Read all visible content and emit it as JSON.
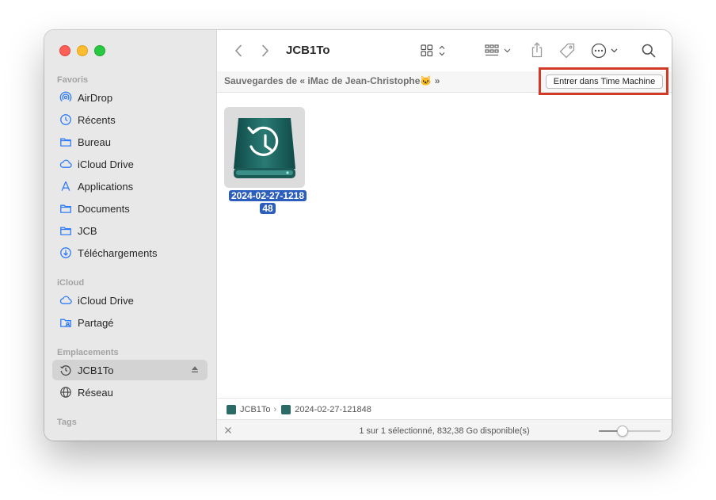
{
  "window": {
    "title": "JCB1To"
  },
  "sidebar": {
    "sections": [
      {
        "title": "Favoris",
        "items": [
          {
            "label": "AirDrop",
            "icon": "airdrop-icon"
          },
          {
            "label": "Récents",
            "icon": "clock-icon"
          },
          {
            "label": "Bureau",
            "icon": "folder-icon"
          },
          {
            "label": "iCloud Drive",
            "icon": "cloud-icon"
          },
          {
            "label": "Applications",
            "icon": "applications-icon"
          },
          {
            "label": "Documents",
            "icon": "folder-icon"
          },
          {
            "label": "JCB",
            "icon": "folder-icon"
          },
          {
            "label": "Téléchargements",
            "icon": "download-icon"
          }
        ]
      },
      {
        "title": "iCloud",
        "items": [
          {
            "label": "iCloud Drive",
            "icon": "cloud-icon"
          },
          {
            "label": "Partagé",
            "icon": "shared-folder-icon"
          }
        ]
      },
      {
        "title": "Emplacements",
        "items": [
          {
            "label": "JCB1To",
            "icon": "time-machine-icon",
            "selected": true
          },
          {
            "label": "Réseau",
            "icon": "globe-icon"
          }
        ]
      },
      {
        "title": "Tags",
        "items": []
      }
    ]
  },
  "time_machine_bar": {
    "backups_label": "Sauvegardes de « iMac de Jean-Christophe🐱 »",
    "enter_button": "Entrer dans Time Machine"
  },
  "files": [
    {
      "name": "2024-02-27-121848",
      "name_line1": "2024-02-27-1218",
      "name_line2": "48",
      "selected": true
    }
  ],
  "pathbar": {
    "items": [
      "JCB1To",
      "2024-02-27-121848"
    ],
    "separator": "›"
  },
  "status": {
    "text": "1 sur 1 sélectionné, 832,38 Go disponible(s)",
    "zoom_level": 0.38
  },
  "colors": {
    "selection": "#2c5fbd",
    "highlight": "#d03a26",
    "sidebar_bg": "#e9e8e8"
  }
}
